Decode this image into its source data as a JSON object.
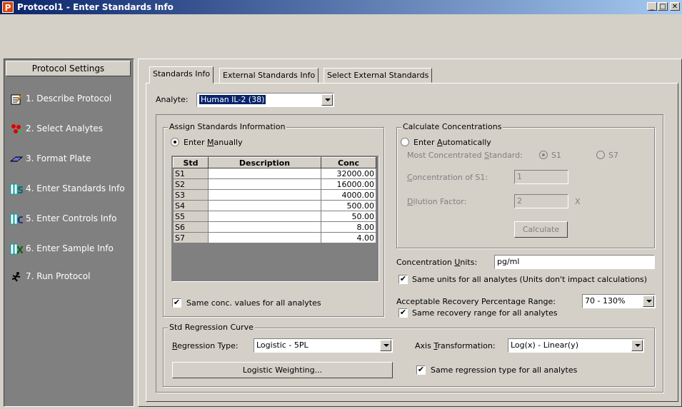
{
  "window": {
    "title": "Protocol1 - Enter Standards Info",
    "app_icon": "P",
    "min": "_",
    "max": "□",
    "close": "✕"
  },
  "sidebar": {
    "header": "Protocol Settings",
    "items": [
      {
        "label": "1. Describe Protocol",
        "icon": "describe-icon"
      },
      {
        "label": "2. Select Analytes",
        "icon": "analytes-icon"
      },
      {
        "label": "3. Format Plate",
        "icon": "plate-icon"
      },
      {
        "label": "4. Enter Standards Info",
        "icon": "standards-icon"
      },
      {
        "label": "5. Enter Controls Info",
        "icon": "controls-icon"
      },
      {
        "label": "6. Enter Sample Info",
        "icon": "sample-icon"
      },
      {
        "label": "7. Run Protocol",
        "icon": "run-icon"
      }
    ]
  },
  "tabs": [
    "Standards Info",
    "External Standards Info",
    "Select External Standards"
  ],
  "analyte": {
    "label": "Analyte:",
    "value": "Human IL-2 (38)"
  },
  "assign": {
    "legend": "Assign Standards Information",
    "radio_pre": "Enter ",
    "radio_u": "M",
    "radio_post": "anually",
    "columns": [
      "Std",
      "Description",
      "Conc"
    ],
    "rows": [
      {
        "std": "S1",
        "desc": "",
        "conc": "32000.00"
      },
      {
        "std": "S2",
        "desc": "",
        "conc": "16000.00"
      },
      {
        "std": "S3",
        "desc": "",
        "conc": "4000.00"
      },
      {
        "std": "S4",
        "desc": "",
        "conc": "500.00"
      },
      {
        "std": "S5",
        "desc": "",
        "conc": "50.00"
      },
      {
        "std": "S6",
        "desc": "",
        "conc": "8.00"
      },
      {
        "std": "S7",
        "desc": "",
        "conc": "4.00"
      }
    ],
    "same_conc_label": "Same conc. values for all analytes"
  },
  "calc": {
    "legend": "Calculate Concentrations",
    "auto_pre": "Enter ",
    "auto_u": "A",
    "auto_post": "utomatically",
    "most_conc_pre": "Most Concentrated ",
    "most_conc_u": "S",
    "most_conc_post": "tandard:",
    "s1": "S1",
    "s7": "S7",
    "conc_s1_u": "C",
    "conc_s1_post": "oncentration of S1:",
    "conc_s1_value": "1",
    "dil_u": "D",
    "dil_post": "ilution Factor:",
    "dil_value": "2",
    "dil_x": "X",
    "calculate": "Calculate"
  },
  "units": {
    "label_pre": "Concentration ",
    "label_u": "U",
    "label_post": "nits:",
    "value": "pg/ml",
    "same_units": "Same units for all analytes  (Units don't impact calculations)"
  },
  "recovery": {
    "label": "Acceptable Recovery Percentage Range:",
    "value": "70 - 130%",
    "same": "Same recovery range for all analytes"
  },
  "regression": {
    "legend": "Std Regression Curve",
    "type_u": "R",
    "type_post": "egression Type:",
    "type_value": "Logistic - 5PL",
    "axis_pre": "Axis ",
    "axis_u": "T",
    "axis_post": "ransformation:",
    "axis_value": "Log(x) - Linear(y)",
    "weighting": "Logistic Weighting...",
    "same": "Same regression type for all analytes"
  },
  "check_mark": "✔"
}
